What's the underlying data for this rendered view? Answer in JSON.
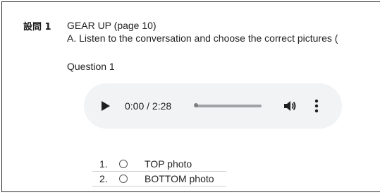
{
  "question": {
    "number_label": "設問 1",
    "title": "GEAR UP (page 10)",
    "instruction": "A. Listen to the conversation and choose the correct pictures (",
    "sub_label": "Question 1"
  },
  "audio_player": {
    "time_display": "0:00 / 2:28",
    "progress_fraction": 0.0,
    "play_icon": "play-icon",
    "volume_icon": "volume-icon",
    "more_icon": "more-vert-icon",
    "background_color": "#f1f3f4"
  },
  "choices": [
    {
      "number": "1.",
      "label": "TOP photo",
      "selected": false
    },
    {
      "number": "2.",
      "label": "BOTTOM photo",
      "selected": false
    }
  ]
}
